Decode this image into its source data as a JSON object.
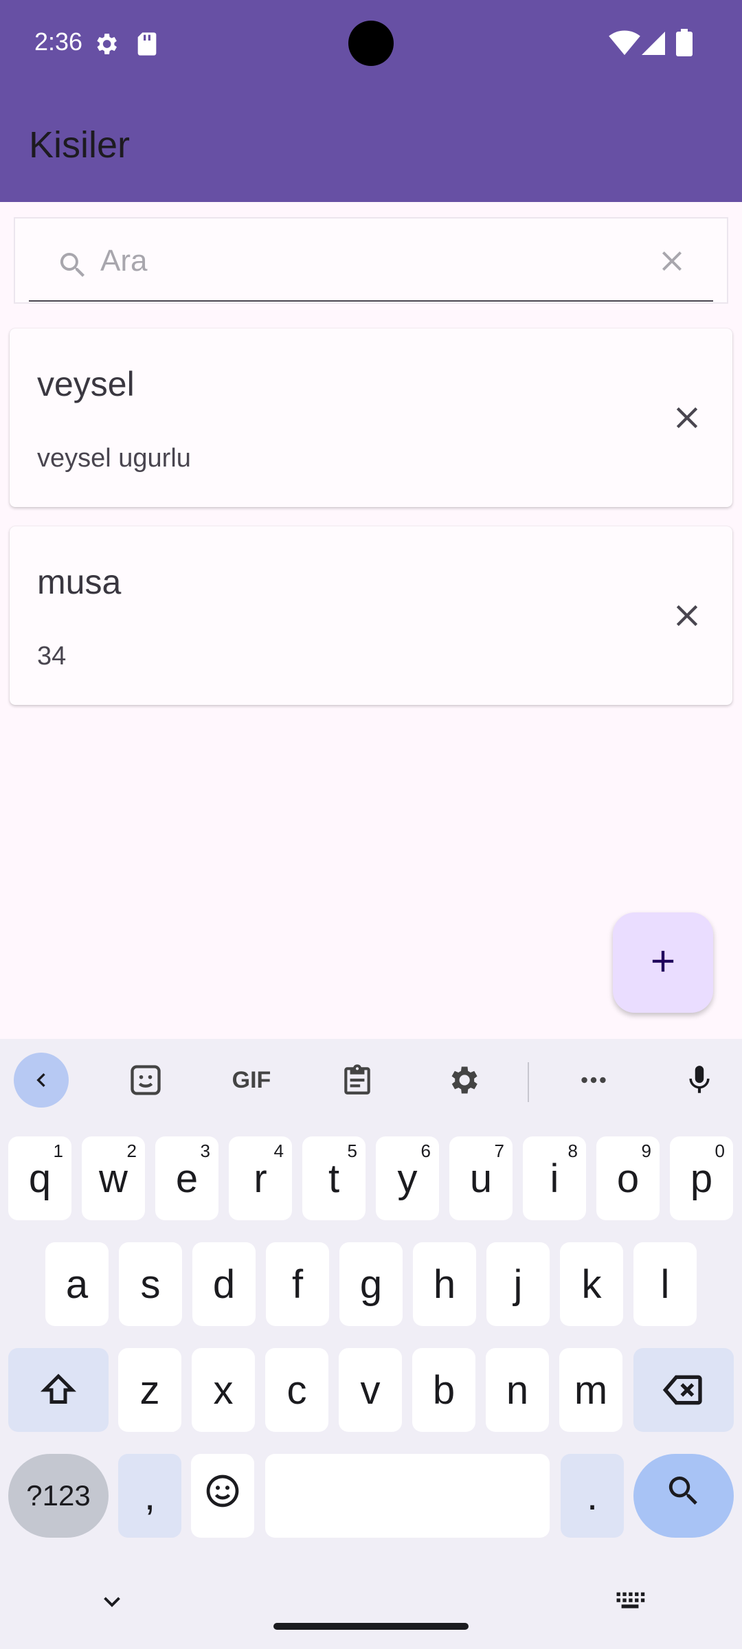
{
  "status_bar": {
    "time": "2:36",
    "icons": [
      "settings-gear-icon",
      "sd-card-icon",
      "wifi-icon",
      "signal-icon",
      "battery-icon"
    ]
  },
  "app_bar": {
    "title": "Kisiler",
    "color": "#6750a4"
  },
  "search": {
    "placeholder": "Ara",
    "value": ""
  },
  "contacts": [
    {
      "name": "veysel",
      "detail": "veysel ugurlu"
    },
    {
      "name": "musa",
      "detail": "34"
    }
  ],
  "fab": {
    "icon": "plus-icon",
    "color": "#eaddff"
  },
  "keyboard": {
    "toolbar": [
      "back-arrow-icon",
      "sticker-icon",
      "GIF",
      "clipboard-icon",
      "settings-icon",
      "more-icon",
      "microphone-icon"
    ],
    "gif_label": "GIF",
    "row1": [
      {
        "key": "q",
        "hint": "1"
      },
      {
        "key": "w",
        "hint": "2"
      },
      {
        "key": "e",
        "hint": "3"
      },
      {
        "key": "r",
        "hint": "4"
      },
      {
        "key": "t",
        "hint": "5"
      },
      {
        "key": "y",
        "hint": "6"
      },
      {
        "key": "u",
        "hint": "7"
      },
      {
        "key": "i",
        "hint": "8"
      },
      {
        "key": "o",
        "hint": "9"
      },
      {
        "key": "p",
        "hint": "0"
      }
    ],
    "row2": [
      "a",
      "s",
      "d",
      "f",
      "g",
      "h",
      "j",
      "k",
      "l"
    ],
    "row3": [
      "z",
      "x",
      "c",
      "v",
      "b",
      "n",
      "m"
    ],
    "symbols_label": "?123",
    "comma": ",",
    "period": "."
  }
}
